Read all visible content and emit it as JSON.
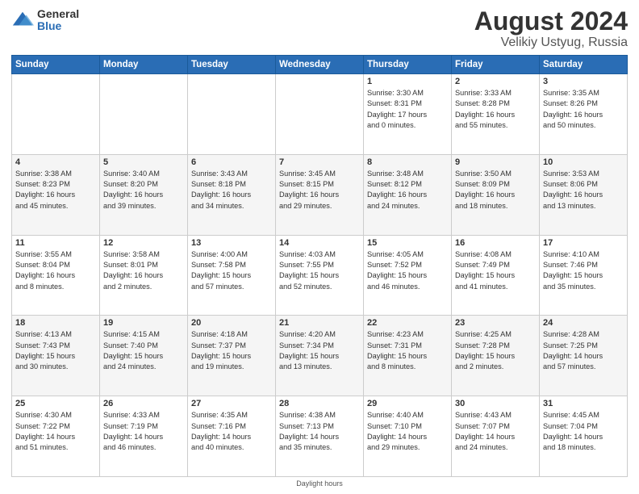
{
  "logo": {
    "general": "General",
    "blue": "Blue"
  },
  "title": {
    "month_year": "August 2024",
    "location": "Velikiy Ustyug, Russia"
  },
  "weekdays": [
    "Sunday",
    "Monday",
    "Tuesday",
    "Wednesday",
    "Thursday",
    "Friday",
    "Saturday"
  ],
  "weeks": [
    [
      {
        "day": "",
        "info": ""
      },
      {
        "day": "",
        "info": ""
      },
      {
        "day": "",
        "info": ""
      },
      {
        "day": "",
        "info": ""
      },
      {
        "day": "1",
        "info": "Sunrise: 3:30 AM\nSunset: 8:31 PM\nDaylight: 17 hours\nand 0 minutes."
      },
      {
        "day": "2",
        "info": "Sunrise: 3:33 AM\nSunset: 8:28 PM\nDaylight: 16 hours\nand 55 minutes."
      },
      {
        "day": "3",
        "info": "Sunrise: 3:35 AM\nSunset: 8:26 PM\nDaylight: 16 hours\nand 50 minutes."
      }
    ],
    [
      {
        "day": "4",
        "info": "Sunrise: 3:38 AM\nSunset: 8:23 PM\nDaylight: 16 hours\nand 45 minutes."
      },
      {
        "day": "5",
        "info": "Sunrise: 3:40 AM\nSunset: 8:20 PM\nDaylight: 16 hours\nand 39 minutes."
      },
      {
        "day": "6",
        "info": "Sunrise: 3:43 AM\nSunset: 8:18 PM\nDaylight: 16 hours\nand 34 minutes."
      },
      {
        "day": "7",
        "info": "Sunrise: 3:45 AM\nSunset: 8:15 PM\nDaylight: 16 hours\nand 29 minutes."
      },
      {
        "day": "8",
        "info": "Sunrise: 3:48 AM\nSunset: 8:12 PM\nDaylight: 16 hours\nand 24 minutes."
      },
      {
        "day": "9",
        "info": "Sunrise: 3:50 AM\nSunset: 8:09 PM\nDaylight: 16 hours\nand 18 minutes."
      },
      {
        "day": "10",
        "info": "Sunrise: 3:53 AM\nSunset: 8:06 PM\nDaylight: 16 hours\nand 13 minutes."
      }
    ],
    [
      {
        "day": "11",
        "info": "Sunrise: 3:55 AM\nSunset: 8:04 PM\nDaylight: 16 hours\nand 8 minutes."
      },
      {
        "day": "12",
        "info": "Sunrise: 3:58 AM\nSunset: 8:01 PM\nDaylight: 16 hours\nand 2 minutes."
      },
      {
        "day": "13",
        "info": "Sunrise: 4:00 AM\nSunset: 7:58 PM\nDaylight: 15 hours\nand 57 minutes."
      },
      {
        "day": "14",
        "info": "Sunrise: 4:03 AM\nSunset: 7:55 PM\nDaylight: 15 hours\nand 52 minutes."
      },
      {
        "day": "15",
        "info": "Sunrise: 4:05 AM\nSunset: 7:52 PM\nDaylight: 15 hours\nand 46 minutes."
      },
      {
        "day": "16",
        "info": "Sunrise: 4:08 AM\nSunset: 7:49 PM\nDaylight: 15 hours\nand 41 minutes."
      },
      {
        "day": "17",
        "info": "Sunrise: 4:10 AM\nSunset: 7:46 PM\nDaylight: 15 hours\nand 35 minutes."
      }
    ],
    [
      {
        "day": "18",
        "info": "Sunrise: 4:13 AM\nSunset: 7:43 PM\nDaylight: 15 hours\nand 30 minutes."
      },
      {
        "day": "19",
        "info": "Sunrise: 4:15 AM\nSunset: 7:40 PM\nDaylight: 15 hours\nand 24 minutes."
      },
      {
        "day": "20",
        "info": "Sunrise: 4:18 AM\nSunset: 7:37 PM\nDaylight: 15 hours\nand 19 minutes."
      },
      {
        "day": "21",
        "info": "Sunrise: 4:20 AM\nSunset: 7:34 PM\nDaylight: 15 hours\nand 13 minutes."
      },
      {
        "day": "22",
        "info": "Sunrise: 4:23 AM\nSunset: 7:31 PM\nDaylight: 15 hours\nand 8 minutes."
      },
      {
        "day": "23",
        "info": "Sunrise: 4:25 AM\nSunset: 7:28 PM\nDaylight: 15 hours\nand 2 minutes."
      },
      {
        "day": "24",
        "info": "Sunrise: 4:28 AM\nSunset: 7:25 PM\nDaylight: 14 hours\nand 57 minutes."
      }
    ],
    [
      {
        "day": "25",
        "info": "Sunrise: 4:30 AM\nSunset: 7:22 PM\nDaylight: 14 hours\nand 51 minutes."
      },
      {
        "day": "26",
        "info": "Sunrise: 4:33 AM\nSunset: 7:19 PM\nDaylight: 14 hours\nand 46 minutes."
      },
      {
        "day": "27",
        "info": "Sunrise: 4:35 AM\nSunset: 7:16 PM\nDaylight: 14 hours\nand 40 minutes."
      },
      {
        "day": "28",
        "info": "Sunrise: 4:38 AM\nSunset: 7:13 PM\nDaylight: 14 hours\nand 35 minutes."
      },
      {
        "day": "29",
        "info": "Sunrise: 4:40 AM\nSunset: 7:10 PM\nDaylight: 14 hours\nand 29 minutes."
      },
      {
        "day": "30",
        "info": "Sunrise: 4:43 AM\nSunset: 7:07 PM\nDaylight: 14 hours\nand 24 minutes."
      },
      {
        "day": "31",
        "info": "Sunrise: 4:45 AM\nSunset: 7:04 PM\nDaylight: 14 hours\nand 18 minutes."
      }
    ]
  ],
  "footer": "Daylight hours"
}
